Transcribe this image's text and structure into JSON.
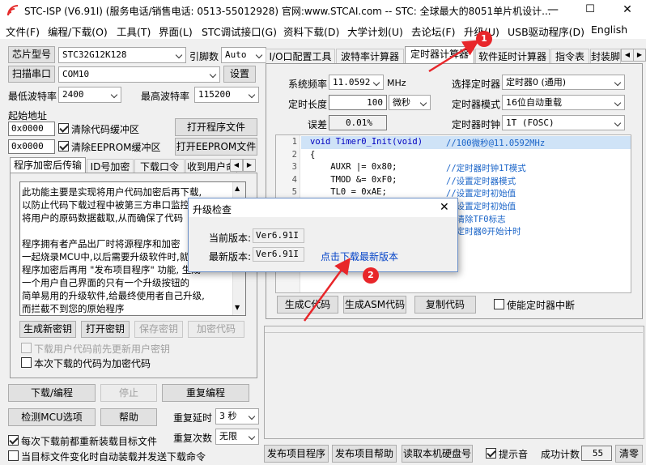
{
  "window": {
    "title": "STC-ISP (V6.91I) (服务电话/销售电话: 0513-55012928) 官网:www.STCAI.com  -- STC: 全球最大的8051单片机设计..."
  },
  "menu": [
    "文件(F)",
    "编程/下载(O)",
    "工具(T)",
    "界面(L)",
    "STC调试接口(G)",
    "资料下载(D)",
    "大学计划(U)",
    "去论坛(F)",
    "升级(U)",
    "USB驱动程序(D)",
    "English"
  ],
  "left": {
    "chip_label": "芯片型号",
    "chip_value": "STC32G12K128",
    "freq_label": "引脚数",
    "freq_value": "Auto",
    "scan_button": "扫描串口",
    "port_value": "COM10",
    "settings_button": "设置",
    "min_baud_label": "最低波特率",
    "min_baud_value": "2400",
    "max_baud_label": "最高波特率",
    "max_baud_value": "115200",
    "start_addr_label": "起始地址",
    "addr1": "0x0000",
    "clear_code_label": "清除代码缓冲区",
    "open_program_button": "打开程序文件",
    "addr2": "0x0000",
    "clear_eeprom_label": "清除EEPROM缓冲区",
    "open_eeprom_button": "打开EEPROM文件",
    "tabs": [
      "程序加密后传输",
      "ID号加密",
      "下载口令",
      "收到用户命"
    ],
    "desc_lines": [
      "此功能主要是实现将用户代码加密后再下载,",
      "以防止代码下载过程中被第三方串口监控",
      "将用户的原码数据截取,从而确保了代码",
      "",
      "程序拥有者产品出厂时将源程序和加密",
      "一起烧录MCU中,以后需要升级软件时,就",
      "程序加密后再用 \"发布项目程序\" 功能, 生成",
      "一个用户自己界面的只有一个升级按钮的",
      "简单易用的升级软件,给最终使用者自己升级,",
      "而拦截不到您的原始程序"
    ],
    "gen_key_button": "生成新密钥",
    "open_key_button": "打开密钥",
    "save_key_button": "保存密钥",
    "encrypt_button": "加密代码",
    "update_key_label": "下载用户代码前先更新用户密钥",
    "encrypt_download_label": "本次下载的代码为加密代码",
    "download_button": "下载/编程",
    "stop_button": "停止",
    "reprogram_button": "重复编程",
    "check_mcu_button": "检测MCU选项",
    "help_button": "帮助",
    "repeat_delay_label": "重复延时",
    "repeat_delay_value": "3 秒",
    "reload_label": "每次下载前都重新装载目标文件",
    "repeat_count_label": "重复次数",
    "repeat_count_value": "无限",
    "auto_load_label": "当目标文件变化时自动装载并发送下载命令"
  },
  "right": {
    "tabs": [
      "I/O口配置工具",
      "波特率计算器",
      "定时器计算器",
      "软件延时计算器",
      "指令表",
      "封装脚"
    ],
    "sysfreq_label": "系统频率",
    "sysfreq_value": "11.0592",
    "sysfreq_unit": "MHz",
    "select_timer_label": "选择定时器",
    "select_timer_value": "定时器0 (通用)",
    "timer_len_label": "定时长度",
    "timer_len_value": "100",
    "timer_unit_value": "微秒",
    "timer_mode_label": "定时器模式",
    "timer_mode_value": "16位自动重载",
    "error_label": "误差",
    "error_value": "0.01%",
    "timer_clock_label": "定时器时钟",
    "timer_clock_value": "1T  (FOSC)",
    "code_lines": [
      {
        "n": "1",
        "code": "void Timer0_Init(void)",
        "comment": "//100微秒@11.0592MHz"
      },
      {
        "n": "2",
        "code": "{",
        "comment": ""
      },
      {
        "n": "3",
        "code": "    AUXR |= 0x80;",
        "comment": "//定时器时钟1T模式"
      },
      {
        "n": "4",
        "code": "    TMOD &= 0xF0;",
        "comment": "//设置定时器模式"
      },
      {
        "n": "5",
        "code": "    TL0 = 0xAE;",
        "comment": "//设置定时初始值"
      },
      {
        "n": "6",
        "code": "",
        "comment": "//设置定时初始值"
      },
      {
        "n": "7",
        "code": "",
        "comment": "//清除TF0标志"
      },
      {
        "n": "8",
        "code": "",
        "comment": "//定时器0开始计时"
      }
    ],
    "gen_c_button": "生成C代码",
    "gen_asm_button": "生成ASM代码",
    "copy_code_button": "复制代码",
    "enable_int_label": "使能定时器中断",
    "publish_button": "发布项目程序",
    "publish_help_button": "发布项目帮助",
    "read_disk_button": "读取本机硬盘号",
    "beep_label": "提示音",
    "success_label": "成功计数",
    "success_value": "55",
    "clear_button": "清零"
  },
  "dialog": {
    "title": "升级检查",
    "close": "✕",
    "current_label": "当前版本:",
    "current_value": "Ver6.91I",
    "latest_label": "最新版本:",
    "latest_value": "Ver6.91I",
    "download_link": "点击下载最新版本"
  },
  "annotations": {
    "badge1": "1",
    "badge2": "2",
    "color": "#e8262a"
  }
}
